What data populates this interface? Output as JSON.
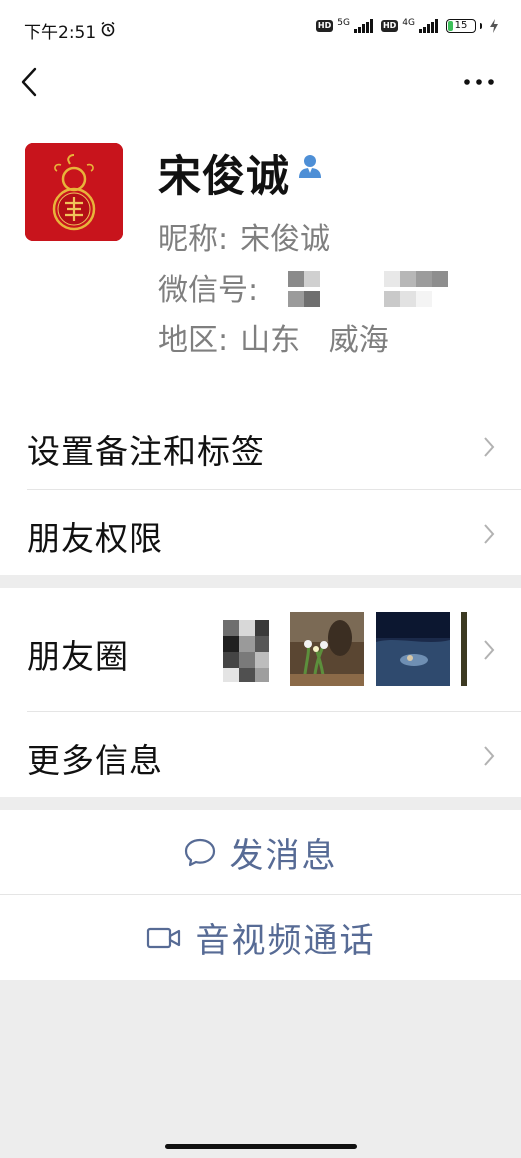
{
  "status_bar": {
    "time": "下午2:51",
    "hd": "HD",
    "net1": "5G",
    "net2": "4G",
    "battery": "15"
  },
  "profile": {
    "name": "宋俊诚",
    "nickname_label": "昵称:",
    "nickname": "宋俊诚",
    "wechat_id_label": "微信号:",
    "region_label": "地区:",
    "region": "山东   威海"
  },
  "settings": {
    "remark_tags": "设置备注和标签",
    "friend_permissions": "朋友权限",
    "moments": "朋友圈",
    "more_info": "更多信息"
  },
  "actions": {
    "send_message": "发消息",
    "video_call": "音视频通话"
  },
  "colors": {
    "accent": "#576b95",
    "background": "#ededed",
    "avatar": "#c8141c"
  }
}
